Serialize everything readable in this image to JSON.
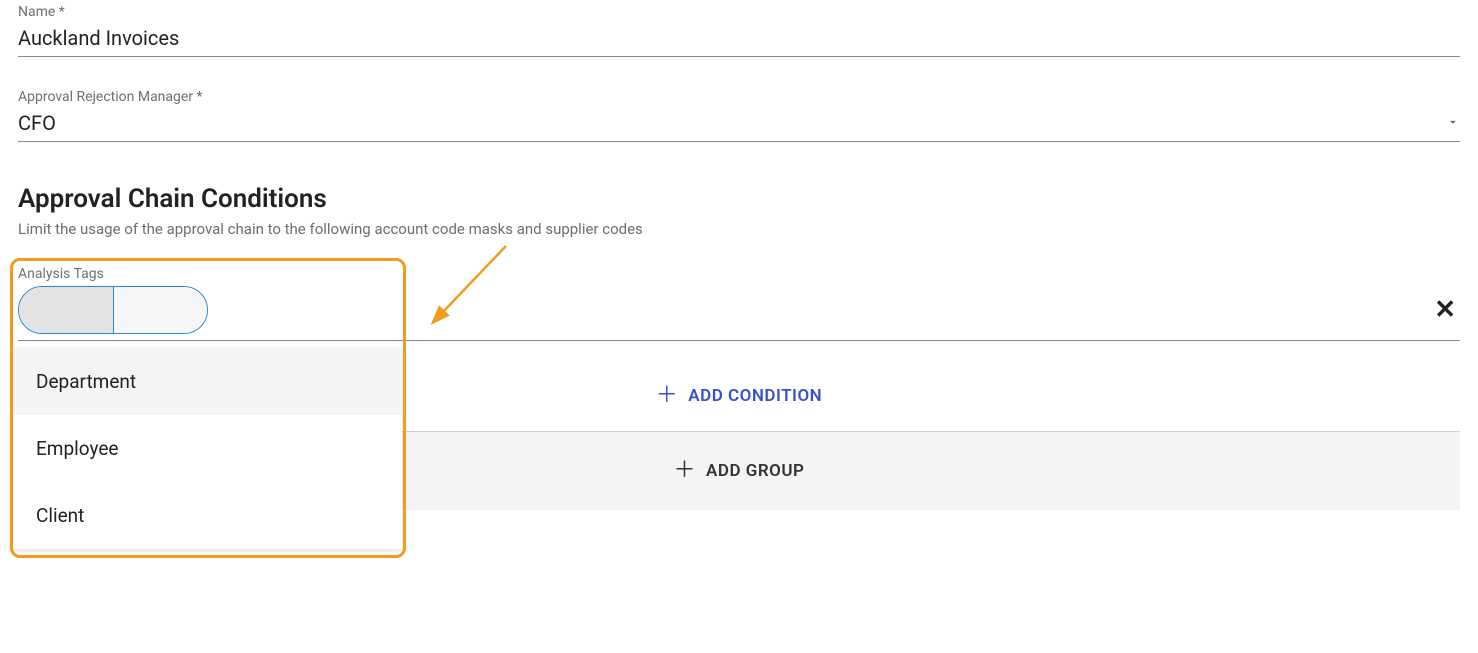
{
  "fields": {
    "name": {
      "label": "Name *",
      "value": "Auckland Invoices"
    },
    "manager": {
      "label": "Approval Rejection Manager *",
      "value": "CFO"
    }
  },
  "section": {
    "title": "Approval Chain Conditions",
    "subtitle": "Limit the usage of the approval chain to the following account code masks and supplier codes"
  },
  "analysis": {
    "label": "Analysis Tags",
    "options": [
      "Department",
      "Employee",
      "Client"
    ]
  },
  "buttons": {
    "addCondition": "ADD CONDITION",
    "addGroup": "ADD GROUP"
  }
}
